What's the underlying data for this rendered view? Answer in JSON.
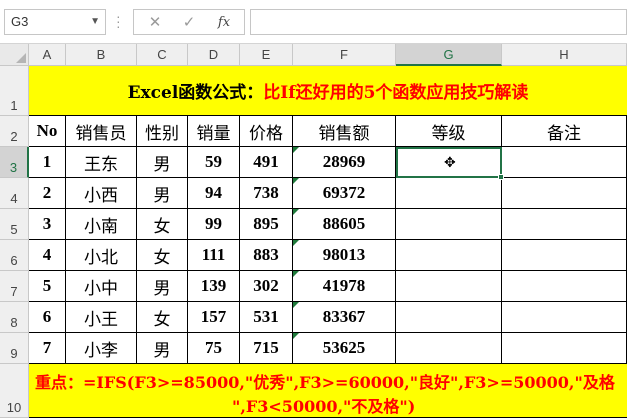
{
  "name_box": "G3",
  "formula_bar": {
    "cancel_icon": "✕",
    "enter_icon": "✓",
    "fx_label": "fx",
    "content": ""
  },
  "columns": [
    "A",
    "B",
    "C",
    "D",
    "E",
    "F",
    "G",
    "H"
  ],
  "rows": [
    "1",
    "2",
    "3",
    "4",
    "5",
    "6",
    "7",
    "8",
    "9",
    "10"
  ],
  "active_cell": {
    "column": "G",
    "row": "3"
  },
  "title": {
    "part1": "Excel函数公式：",
    "part2": "比If还好用的5个函数应用技巧解读"
  },
  "table": {
    "headers": [
      "No",
      "销售员",
      "性别",
      "销量",
      "价格",
      "销售额",
      "等级",
      "备注"
    ],
    "rows": [
      [
        "1",
        "王东",
        "男",
        "59",
        "491",
        "28969",
        "",
        ""
      ],
      [
        "2",
        "小西",
        "男",
        "94",
        "738",
        "69372",
        "",
        ""
      ],
      [
        "3",
        "小南",
        "女",
        "99",
        "895",
        "88605",
        "",
        ""
      ],
      [
        "4",
        "小北",
        "女",
        "111",
        "883",
        "98013",
        "",
        ""
      ],
      [
        "5",
        "小中",
        "男",
        "139",
        "302",
        "41978",
        "",
        ""
      ],
      [
        "6",
        "小王",
        "女",
        "157",
        "531",
        "83367",
        "",
        ""
      ],
      [
        "7",
        "小李",
        "男",
        "75",
        "715",
        "53625",
        "",
        ""
      ]
    ]
  },
  "note": {
    "line1": "重点：=IFS(F3>=85000,\"优秀\",F3>=60000,\"良好\",F3>=50000,\"及格",
    "line2": "\",F3<50000,\"不及格\")"
  },
  "colors": {
    "highlight": "#ffff00",
    "red_text": "#ff0000",
    "selection": "#217346"
  }
}
